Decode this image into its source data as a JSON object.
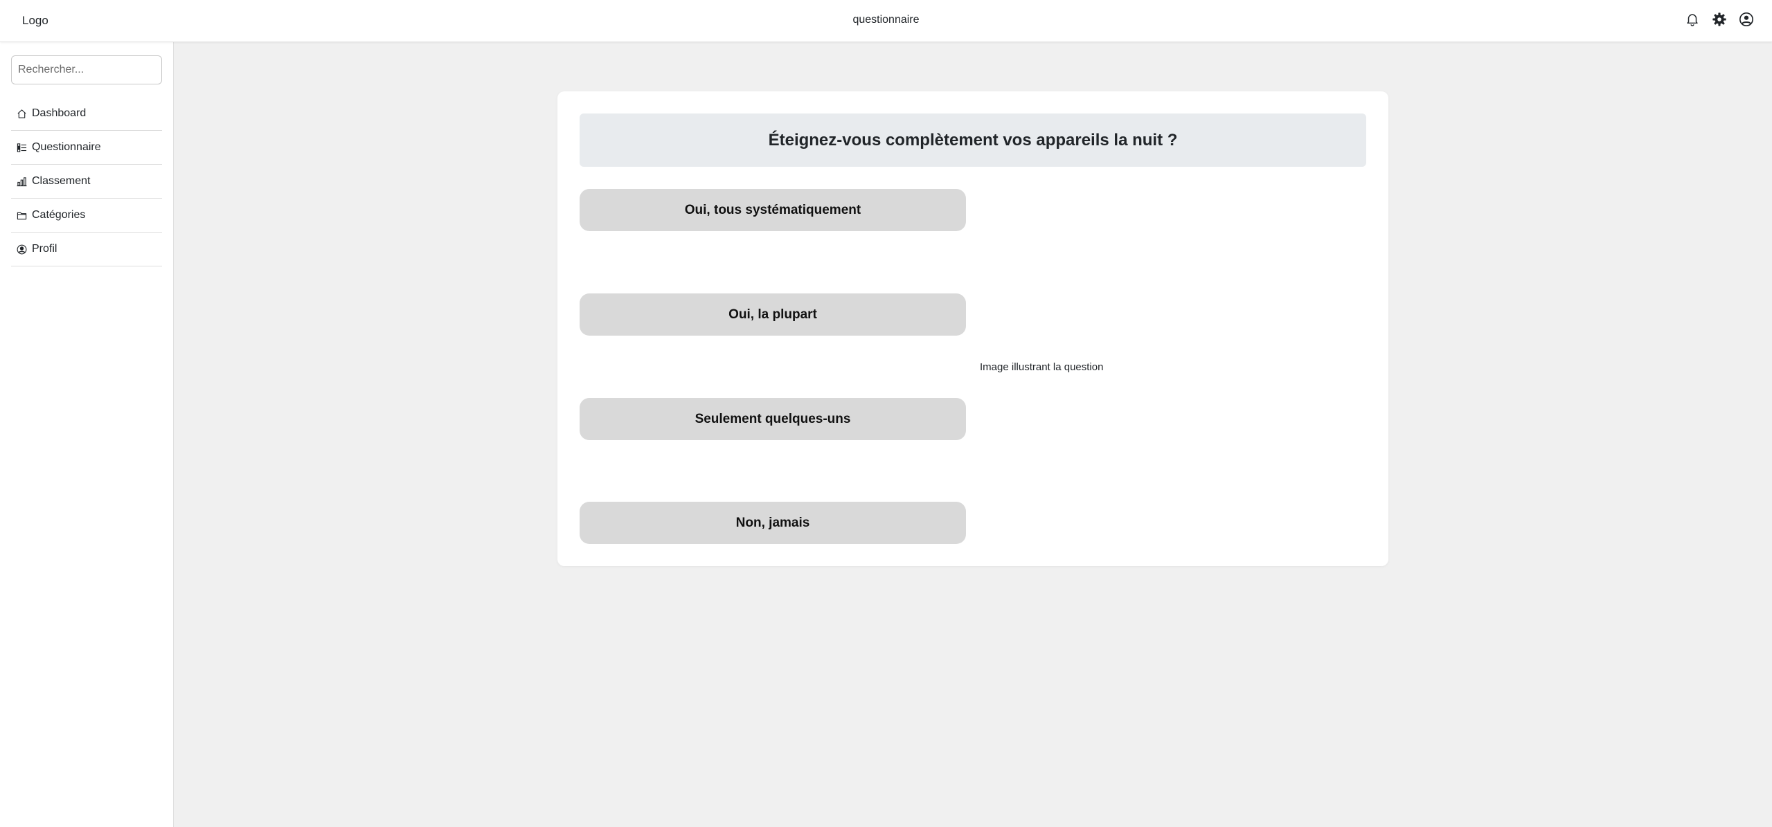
{
  "header": {
    "logo": "Logo",
    "page_title": "questionnaire",
    "icons": [
      "bell-icon",
      "gear-icon",
      "user-circle-icon"
    ]
  },
  "sidebar": {
    "search_placeholder": "Rechercher...",
    "items": [
      {
        "label": "Dashboard",
        "icon": "home-icon"
      },
      {
        "label": "Questionnaire",
        "icon": "list-icon"
      },
      {
        "label": "Classement",
        "icon": "bar-chart-icon"
      },
      {
        "label": "Catégories",
        "icon": "folder-icon"
      },
      {
        "label": "Profil",
        "icon": "user-circle-icon"
      }
    ]
  },
  "main": {
    "question": "Éteignez-vous complètement vos appareils la nuit ?",
    "answers": [
      "Oui, tous systématiquement",
      "Oui, la plupart",
      "Seulement quelques-uns",
      "Non, jamais"
    ],
    "image_alt": "Image illustrant la question"
  },
  "colors": {
    "page_background": "#f0f0f0",
    "question_background": "#e8ebee",
    "answer_background": "#d9d9d9"
  }
}
